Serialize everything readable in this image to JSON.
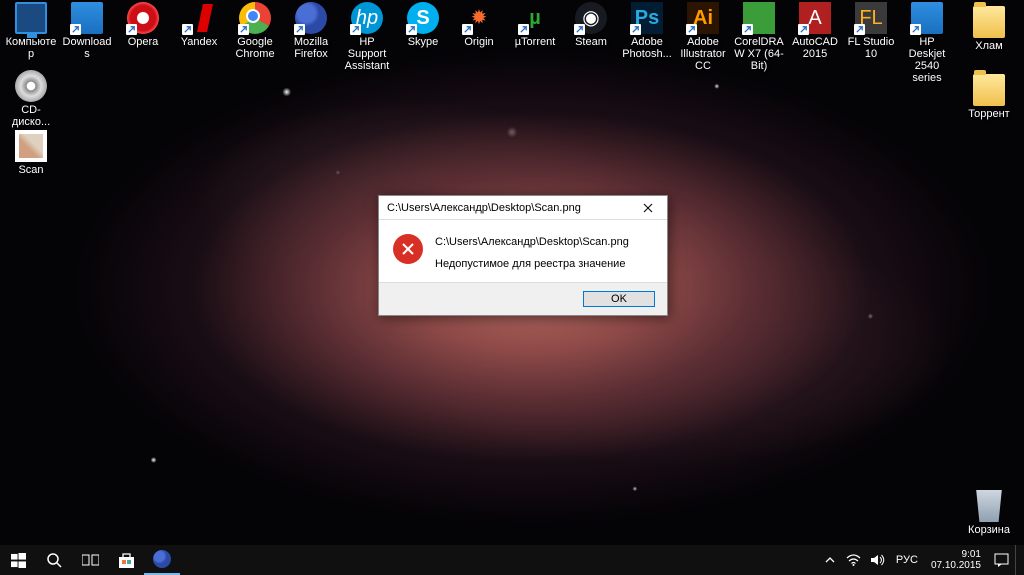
{
  "desktop_icons": {
    "row1": [
      {
        "label": "Компьютер",
        "type": "monitor"
      },
      {
        "label": "Downloads",
        "type": "app-blue"
      },
      {
        "label": "Opera",
        "type": "opera"
      },
      {
        "label": "Yandex",
        "type": "yandex"
      },
      {
        "label": "Google Chrome",
        "type": "chrome"
      },
      {
        "label": "Mozilla Firefox",
        "type": "firefox"
      },
      {
        "label": "HP Support Assistant",
        "type": "hp",
        "text": "hp"
      },
      {
        "label": "Skype",
        "type": "skype",
        "text": "S"
      },
      {
        "label": "Origin",
        "type": "origin",
        "text": "✹"
      },
      {
        "label": "µTorrent",
        "type": "ut",
        "text": "µ"
      },
      {
        "label": "Steam",
        "type": "steam",
        "text": "◉"
      },
      {
        "label": "Adobe Photosh...",
        "type": "ps",
        "text": "Ps"
      },
      {
        "label": "Adobe Illustrator CC",
        "type": "ai",
        "text": "Ai"
      },
      {
        "label": "CorelDRAW X7 (64-Bit)",
        "type": "cdr"
      },
      {
        "label": "AutoCAD 2015",
        "type": "acad",
        "text": "A"
      },
      {
        "label": "FL Studio 10",
        "type": "fl",
        "text": "FL"
      },
      {
        "label": "HP Deskjet 2540 series",
        "type": "app-blue"
      },
      {
        "label": "Хлам",
        "type": "folder",
        "no_shortcut": true
      }
    ],
    "row2_left": {
      "label": "CD-диско...",
      "type": "disc",
      "no_shortcut": true
    },
    "row2_right": {
      "label": "Торрент",
      "type": "folder",
      "no_shortcut": true
    },
    "row3_left": {
      "label": "Scan",
      "type": "png",
      "no_shortcut": true
    },
    "bin": {
      "label": "Корзина",
      "type": "bin",
      "no_shortcut": true
    }
  },
  "dialog": {
    "title": "C:\\Users\\Александр\\Desktop\\Scan.png",
    "line1": "C:\\Users\\Александр\\Desktop\\Scan.png",
    "line2": "Недопустимое для реестра значение",
    "ok": "OK"
  },
  "taskbar": {
    "lang": "РУС",
    "time": "9:01",
    "date": "07.10.2015"
  }
}
